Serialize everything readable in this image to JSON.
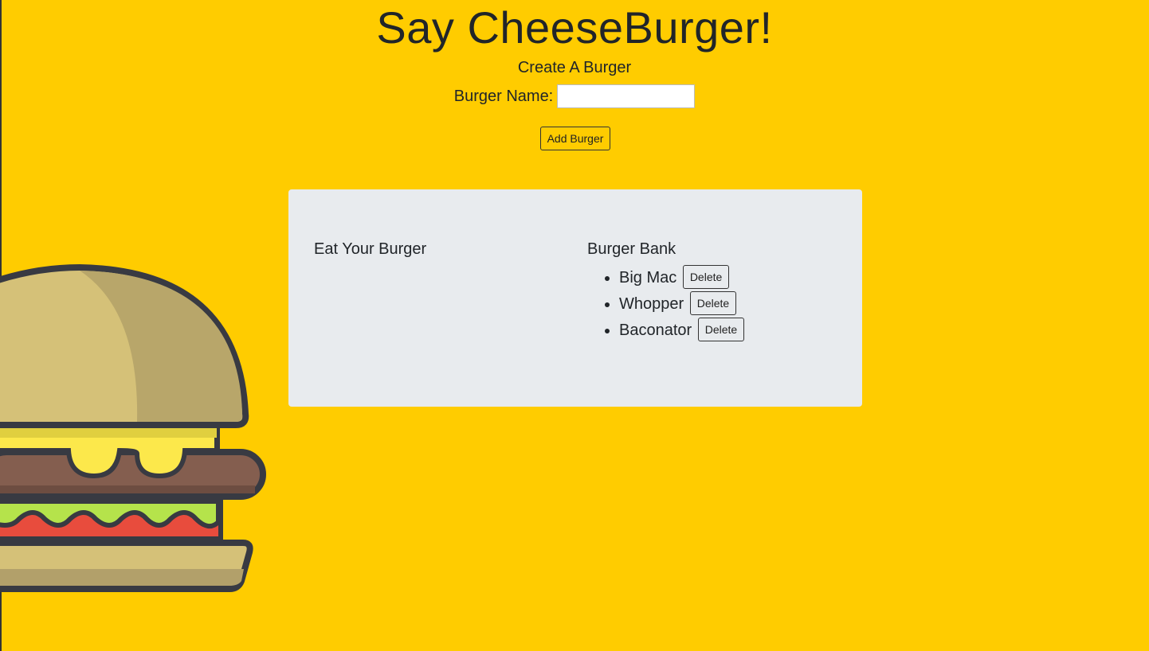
{
  "page": {
    "title": "Say CheeseBurger!",
    "subtitle": "Create A Burger"
  },
  "form": {
    "name_label": "Burger Name:",
    "name_value": "",
    "add_label": "Add Burger"
  },
  "panel": {
    "eat_heading": "Eat Your Burger",
    "eaten_burgers": [],
    "bank_heading": "Burger Bank",
    "bank_burgers": [
      {
        "name": "Big Mac",
        "action": "Delete"
      },
      {
        "name": "Whopper",
        "action": "Delete"
      },
      {
        "name": "Baconator",
        "action": "Delete"
      }
    ]
  },
  "colors": {
    "background": "#ffcc00",
    "panel": "#e8ebee",
    "text": "#212529"
  },
  "icons": {
    "illustration": "cheeseburger-illustration"
  }
}
